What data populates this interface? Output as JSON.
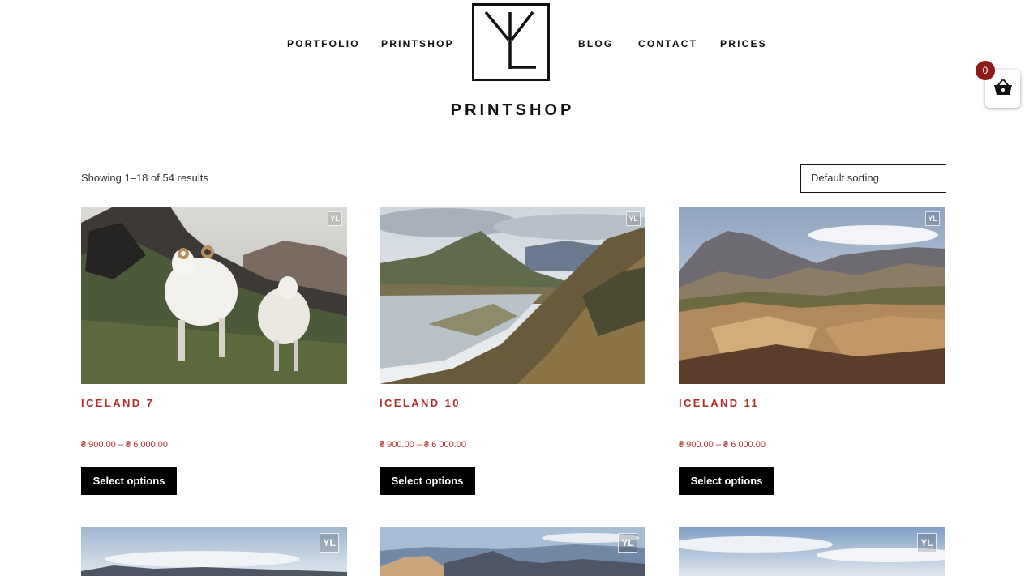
{
  "nav": {
    "left": [
      "PORTFOLIO",
      "PRINTSHOP"
    ],
    "right": [
      "BLOG",
      "CONTACT",
      "PRICES"
    ]
  },
  "page_title": "PRINTSHOP",
  "cart": {
    "count": "0"
  },
  "shop": {
    "result_count": "Showing 1–18 of 54 results",
    "sorting": "Default sorting"
  },
  "products": [
    {
      "title": "ICELAND 7",
      "price": "₴ 900.00 – ₴ 6 000.00",
      "button": "Select options"
    },
    {
      "title": "ICELAND 10",
      "price": "₴ 900.00 – ₴ 6 000.00",
      "button": "Select options"
    },
    {
      "title": "ICELAND 11",
      "price": "₴ 900.00 – ₴ 6 000.00",
      "button": "Select options"
    }
  ],
  "watermark_text": "YL",
  "colors": {
    "accent": "#b0302a",
    "badge": "#8e1a1a",
    "button": "#000000"
  }
}
